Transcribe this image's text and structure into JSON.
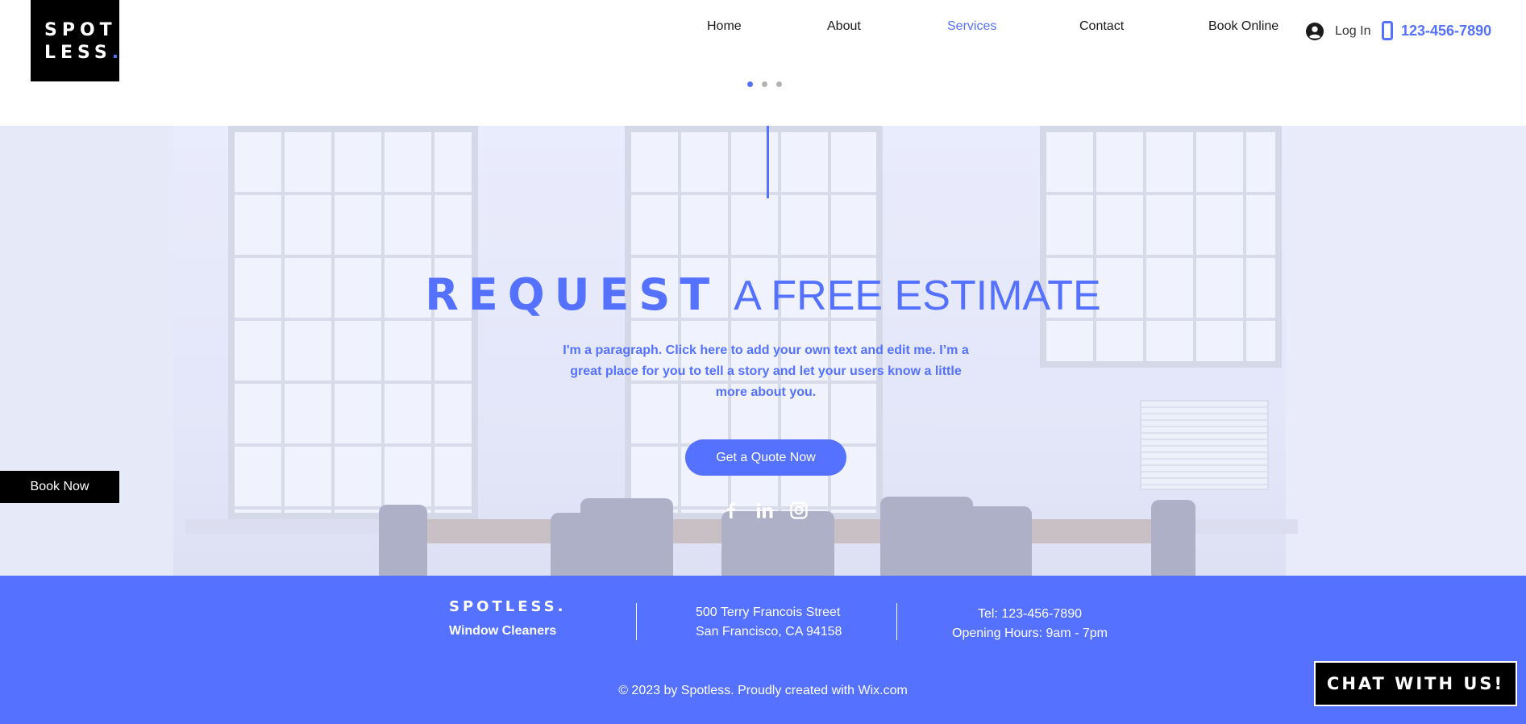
{
  "brand": {
    "logo_line1": "SPOT",
    "logo_line2": "LESS",
    "logo_dot": "."
  },
  "nav": {
    "items": [
      {
        "label": "Home",
        "active": false
      },
      {
        "label": "About",
        "active": false
      },
      {
        "label": "Services",
        "active": true
      },
      {
        "label": "Contact",
        "active": false
      },
      {
        "label": "Book Online",
        "active": false
      }
    ],
    "login_label": "Log In",
    "login_icon": "user-avatar-icon",
    "phone": "123-456-7890",
    "phone_icon": "smartphone-icon"
  },
  "slider": {
    "count": 3,
    "active_index": 0
  },
  "hero": {
    "headline_bold": "REQUEST",
    "headline_light": "A FREE ESTIMATE",
    "paragraph": "I'm a paragraph. Click here to add your own text and edit me. I’m a great place for you to tell a story and let your users know a little more about you.",
    "cta_label": "Get a Quote Now",
    "social": [
      {
        "name": "facebook-icon"
      },
      {
        "name": "linkedin-icon"
      },
      {
        "name": "instagram-icon"
      }
    ],
    "book_now_label": "Book Now"
  },
  "footer": {
    "brand": "SPOTLESS.",
    "tagline": "Window Cleaners",
    "address_line1": "500 Terry Francois Street",
    "address_line2": "San Francisco, CA 94158",
    "tel": "Tel: 123-456-7890",
    "hours": "Opening Hours: 9am - 7pm",
    "copyright": "© 2023 by Spotless. Proudly created with Wix.com"
  },
  "chat": {
    "label": "CHAT WITH US!"
  },
  "colors": {
    "accent": "#5471ff",
    "black": "#000000",
    "white": "#ffffff"
  }
}
